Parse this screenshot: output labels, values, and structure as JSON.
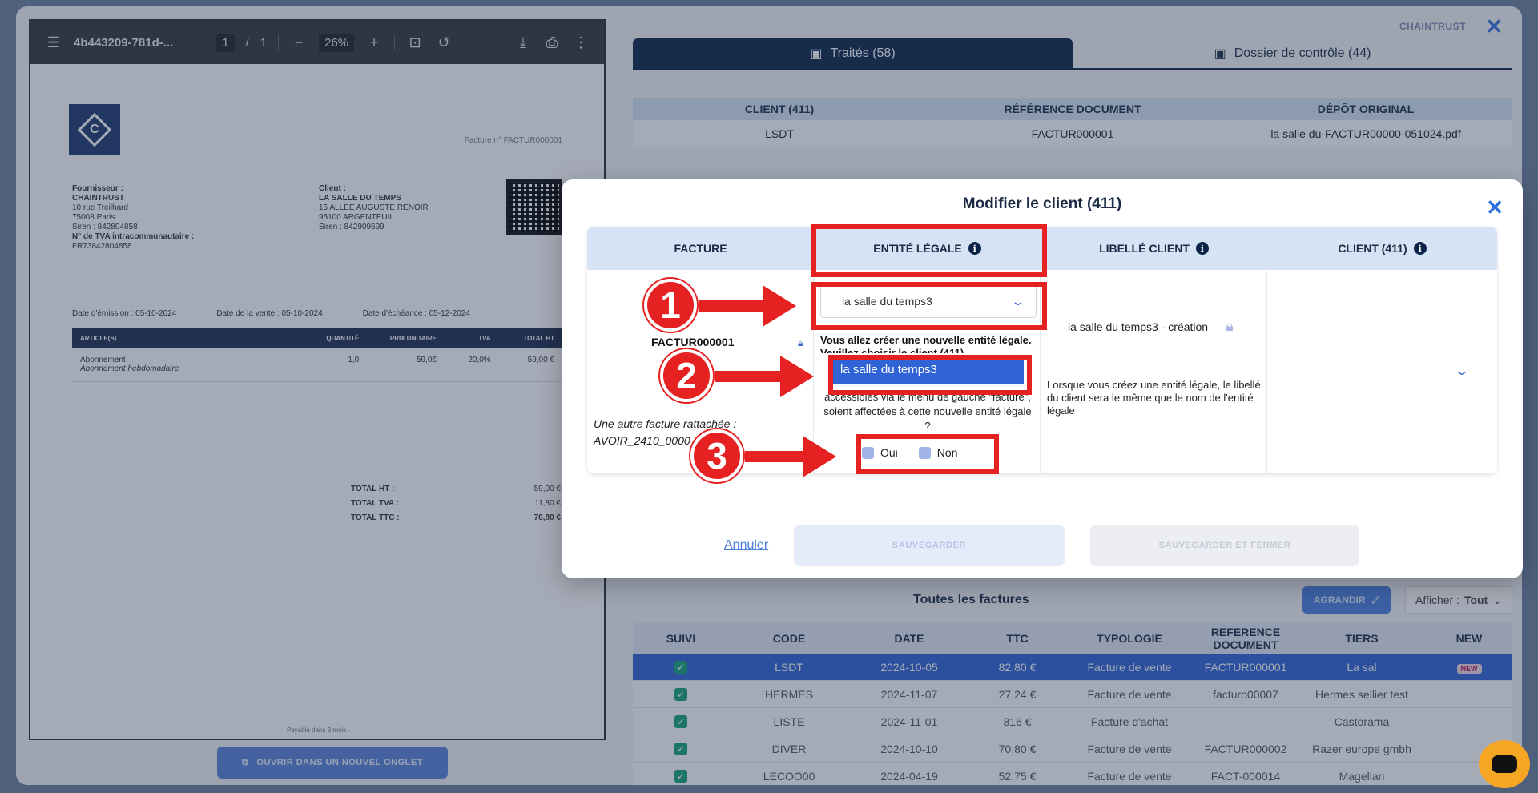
{
  "app": {
    "brand": "CHAINTRUST",
    "close": "✕"
  },
  "pdf": {
    "filename": "4b443209-781d-...",
    "page_current": "1",
    "page_sep": "/",
    "page_total": "1",
    "zoom": "26%",
    "invoice_no": "Facture n° FACTUR000001",
    "supplier_lines": [
      "Fournisseur :",
      "CHAINTRUST",
      "10 rue Treilhard",
      "75008 Paris",
      "Siren : 842804858",
      "N° de TVA intracommunautaire :",
      "FR73842804858"
    ],
    "client_lines": [
      "Client :",
      "LA SALLE DU TEMPS",
      "15 ALLEE AUGUSTE RENOIR",
      "95100 ARGENTEUIL",
      "Siren : 842909699"
    ],
    "date_emission": "Date d'émission : 05-10-2024",
    "date_vente": "Date de la vente : 05-10-2024",
    "date_echeance": "Date d'échéance : 05-12-2024",
    "table_head": [
      "ARTICLE(S)",
      "QUANTITÉ",
      "PRIX UNITAIRE",
      "TVA",
      "TOTAL HT"
    ],
    "row": {
      "article": "Abonnement",
      "desc": "Abonnement hebdomadaire",
      "qty": "1,0",
      "pu": "59,0€",
      "tva": "20,0%",
      "total": "59,00 €"
    },
    "total_ht_label": "TOTAL HT :",
    "total_ht": "59,00 €",
    "total_tva_label": "TOTAL TVA :",
    "total_tva": "11,80 €",
    "total_ttc_label": "TOTAL TTC :",
    "total_ttc": "70,80 €",
    "footer": "Payable dans 3 mois -",
    "logo_letter": "C"
  },
  "open_tab_label": "OUVRIR DANS UN NOUVEL ONGLET",
  "tabs": [
    {
      "label": "Traités (58)"
    },
    {
      "label": "Dossier de contrôle (44)"
    }
  ],
  "info_grid": {
    "headers": [
      "CLIENT (411)",
      "RÉFÉRENCE DOCUMENT",
      "DÉPÔT ORIGINAL"
    ],
    "client": "LSDT",
    "reference": "FACTUR000001",
    "depot": "la salle du-FACTUR00000-051024.pdf"
  },
  "all_invoices_title": "Toutes les factures",
  "grandir_label": "AGRANDIR",
  "afficher_label": "Afficher :",
  "afficher_value": "Tout",
  "list": {
    "headers": [
      "SUIVI",
      "CODE",
      "DATE",
      "TTC",
      "TYPOLOGIE",
      "REFERENCE DOCUMENT",
      "TIERS",
      "NEW"
    ],
    "rows": [
      {
        "code": "LSDT",
        "date": "2024-10-05",
        "ttc": "82,80 €",
        "typo": "Facture de vente",
        "ref": "FACTUR000001",
        "tiers": "La sal",
        "new": "NEW"
      },
      {
        "code": "HERMES",
        "date": "2024-11-07",
        "ttc": "27,24 €",
        "typo": "Facture de vente",
        "ref": "facturo00007",
        "tiers": "Hermes sellier test",
        "new": ""
      },
      {
        "code": "LISTE",
        "date": "2024-11-01",
        "ttc": "816 €",
        "typo": "Facture d'achat",
        "ref": "",
        "tiers": "Castorama",
        "new": ""
      },
      {
        "code": "DIVER",
        "date": "2024-10-10",
        "ttc": "70,80 €",
        "typo": "Facture de vente",
        "ref": "FACTUR000002",
        "tiers": "Razer europe gmbh",
        "new": ""
      },
      {
        "code": "LECOO00",
        "date": "2024-04-19",
        "ttc": "52,75 €",
        "typo": "Facture de vente",
        "ref": "FACT-000014",
        "tiers": "Magellan",
        "new": ""
      }
    ]
  },
  "modal": {
    "title": "Modifier le client (411)",
    "close": "✕",
    "headers": [
      "FACTURE",
      "ENTITÉ LÉGALE",
      "LIBELLÉ CLIENT",
      "CLIENT (411)"
    ],
    "facture_code": "FACTUR000001",
    "other_invoice": "Une autre facture rattachée : AVOIR_2410_0000",
    "entity_selected": "la salle du temps3",
    "warning": "Vous allez créer une nouvelle entité légale. Veuillez choisir le client (411)",
    "dropdown_option": "la salle du temps3",
    "question": "accessibles via le menu de gauche \"facture\", soient affectées à cette nouvelle entité légale ?",
    "radio_yes": "Oui",
    "radio_no": "Non",
    "libelle_value": "la salle du temps3 - création",
    "libelle_note": "Lorsque vous créez une entité légale, le libellé du client sera le même que le nom de l'entité légale",
    "cancel": "Annuler",
    "save": "SAUVEGARDER",
    "save_close": "SAUVEGARDER ET FERMER"
  },
  "annotations": [
    "1",
    "2",
    "3"
  ],
  "colors": {
    "accent": "#2f63d6",
    "navy": "#0b2346",
    "highlight": "#e62121"
  }
}
